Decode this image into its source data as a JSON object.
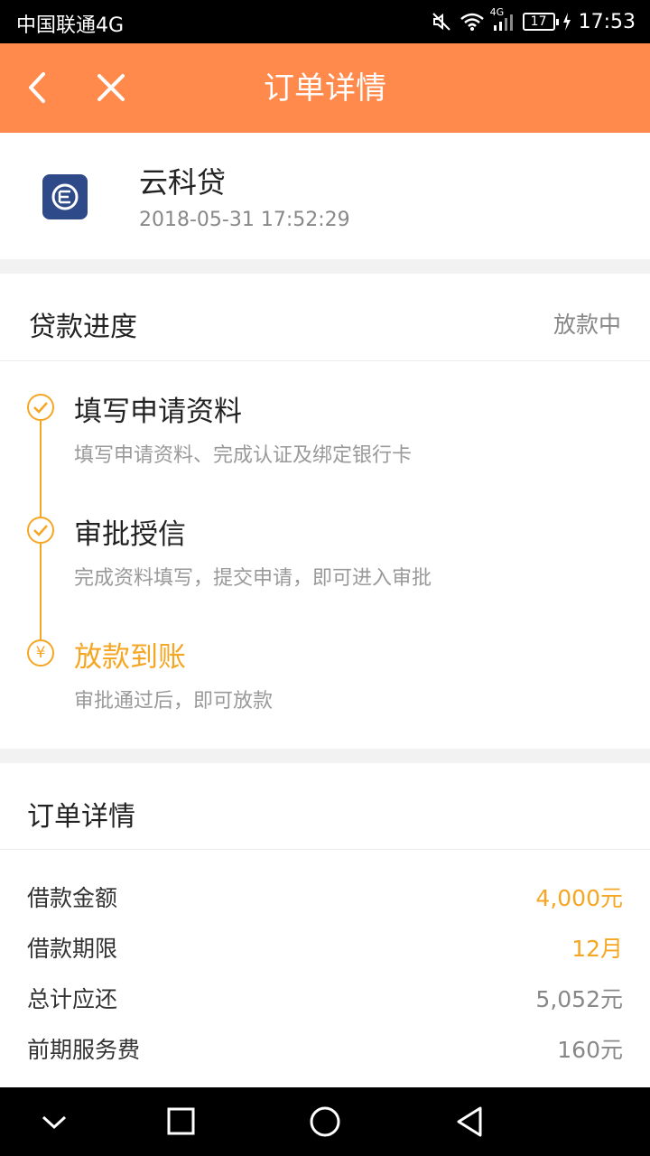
{
  "status_bar": {
    "carrier": "中国联通4G",
    "network": "4G",
    "battery": "17",
    "time": "17:53"
  },
  "header": {
    "title": "订单详情"
  },
  "app": {
    "name": "云科贷",
    "datetime": "2018-05-31 17:52:29"
  },
  "progress": {
    "label": "贷款进度",
    "status": "放款中",
    "steps": [
      {
        "title": "填写申请资料",
        "desc": "填写申请资料、完成认证及绑定银行卡",
        "icon": "check-circle-icon"
      },
      {
        "title": "审批授信",
        "desc": "完成资料填写，提交申请，即可进入审批",
        "icon": "check-circle-icon"
      },
      {
        "title": "放款到账",
        "desc": "审批通过后，即可放款",
        "icon": "yen-circle-icon",
        "symbol": "¥"
      }
    ]
  },
  "details": {
    "label": "订单详情",
    "rows": [
      {
        "key": "借款金额",
        "value": "4,000元"
      },
      {
        "key": "借款期限",
        "value": "12月"
      },
      {
        "key": "总计应还",
        "value": "5,052元"
      },
      {
        "key": "前期服务费",
        "value": "160元"
      }
    ]
  },
  "colors": {
    "header": "#ff8a4c",
    "accent": "#f5a623",
    "logo": "#2f4a88"
  }
}
